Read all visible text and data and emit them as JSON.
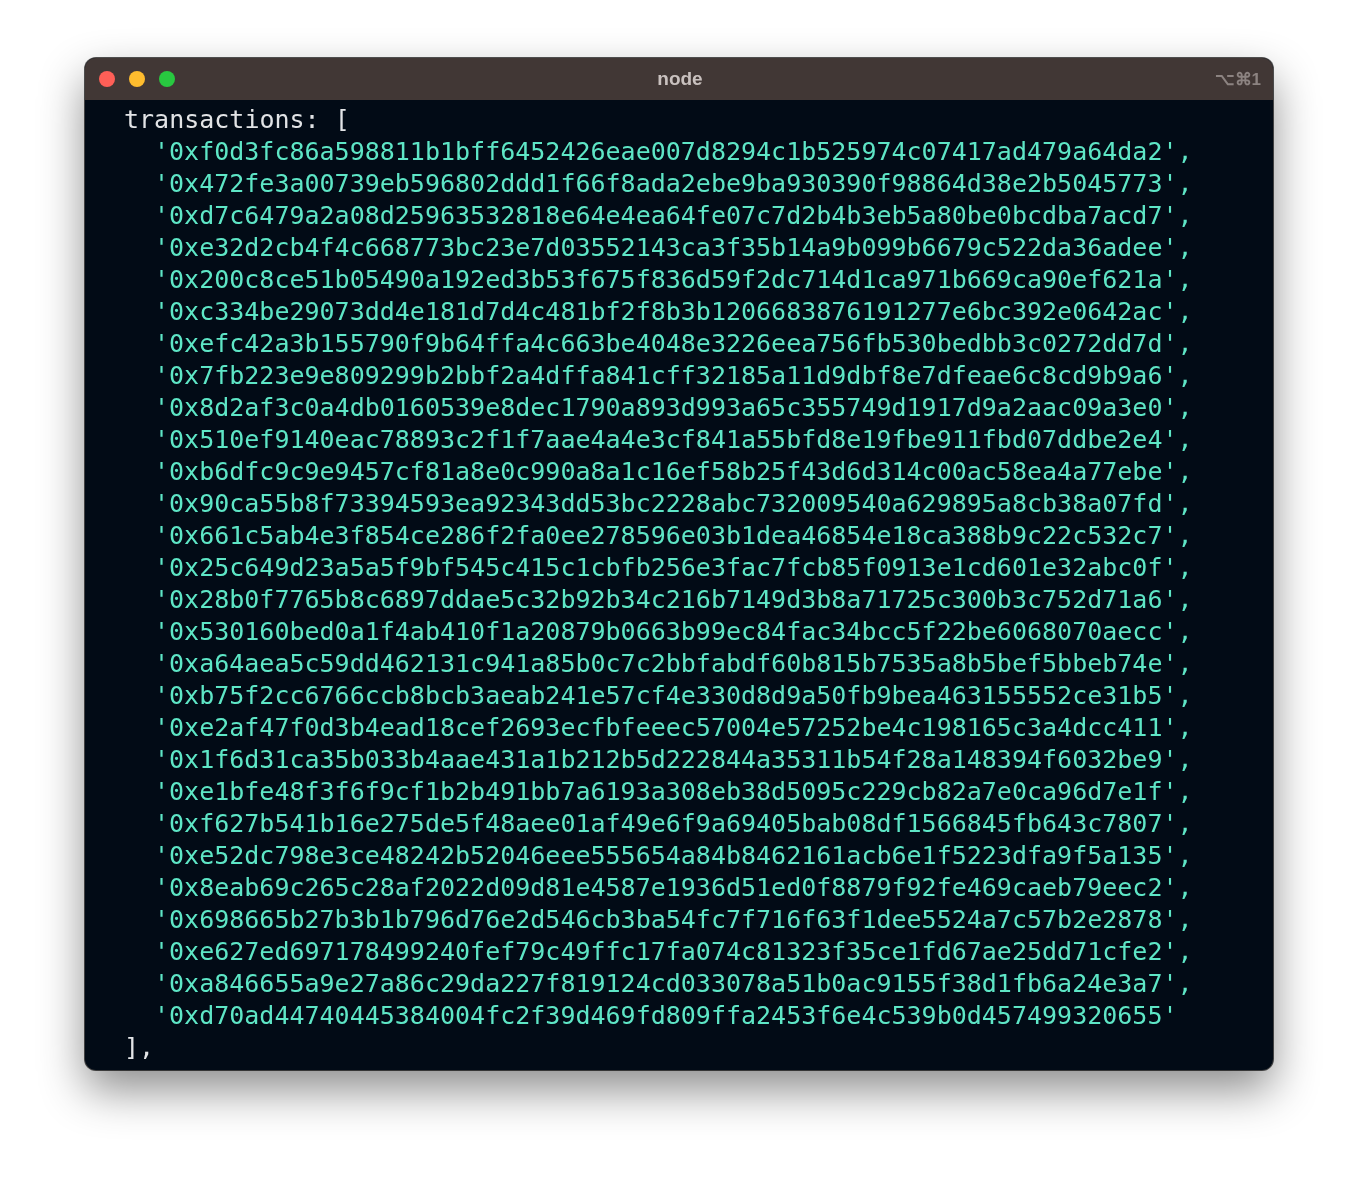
{
  "window": {
    "title": "node",
    "shortcut": "⌥⌘1"
  },
  "terminal": {
    "opening": "transactions: [",
    "lines": [
      "'0xf0d3fc86a598811b1bff6452426eae007d8294c1b525974c07417ad479a64da2',",
      "'0x472fe3a00739eb596802ddd1f66f8ada2ebe9ba930390f98864d38e2b5045773',",
      "'0xd7c6479a2a08d25963532818e64e4ea64fe07c7d2b4b3eb5a80be0bcdba7acd7',",
      "'0xe32d2cb4f4c668773bc23e7d03552143ca3f35b14a9b099b6679c522da36adee',",
      "'0x200c8ce51b05490a192ed3b53f675f836d59f2dc714d1ca971b669ca90ef621a',",
      "'0xc334be29073dd4e181d7d4c481bf2f8b3b1206683876191277e6bc392e0642ac',",
      "'0xefc42a3b155790f9b64ffa4c663be4048e3226eea756fb530bedbb3c0272dd7d',",
      "'0x7fb223e9e809299b2bbf2a4dffa841cff32185a11d9dbf8e7dfeae6c8cd9b9a6',",
      "'0x8d2af3c0a4db0160539e8dec1790a893d993a65c355749d1917d9a2aac09a3e0',",
      "'0x510ef9140eac78893c2f1f7aae4a4e3cf841a55bfd8e19fbe911fbd07ddbe2e4',",
      "'0xb6dfc9c9e9457cf81a8e0c990a8a1c16ef58b25f43d6d314c00ac58ea4a77ebe',",
      "'0x90ca55b8f73394593ea92343dd53bc2228abc732009540a629895a8cb38a07fd',",
      "'0x661c5ab4e3f854ce286f2fa0ee278596e03b1dea46854e18ca388b9c22c532c7',",
      "'0x25c649d23a5a5f9bf545c415c1cbfb256e3fac7fcb85f0913e1cd601e32abc0f',",
      "'0x28b0f7765b8c6897ddae5c32b92b34c216b7149d3b8a71725c300b3c752d71a6',",
      "'0x530160bed0a1f4ab410f1a20879b0663b99ec84fac34bcc5f22be6068070aecc',",
      "'0xa64aea5c59dd462131c941a85b0c7c2bbfabdf60b815b7535a8b5bef5bbeb74e',",
      "'0xb75f2cc6766ccb8bcb3aeab241e57cf4e330d8d9a50fb9bea463155552ce31b5',",
      "'0xe2af47f0d3b4ead18cef2693ecfbfeeec57004e57252be4c198165c3a4dcc411',",
      "'0x1f6d31ca35b033b4aae431a1b212b5d222844a35311b54f28a148394f6032be9',",
      "'0xe1bfe48f3f6f9cf1b2b491bb7a6193a308eb38d5095c229cb82a7e0ca96d7e1f',",
      "'0xf627b541b16e275de5f48aee01af49e6f9a69405bab08df1566845fb643c7807',",
      "'0xe52dc798e3ce48242b52046eee555654a84b8462161acb6e1f5223dfa9f5a135',",
      "'0x8eab69c265c28af2022d09d81e4587e1936d51ed0f8879f92fe469caeb79eec2',",
      "'0x698665b27b3b1b796d76e2d546cb3ba54fc7f716f63f1dee5524a7c57b2e2878',",
      "'0xe627ed697178499240fef79c49ffc17fa074c81323f35ce1fd67ae25dd71cfe2',",
      "'0xa846655a9e27a86c29da227f819124cd033078a51b0ac9155f38d1fb6a24e3a7',",
      "'0xd70ad44740445384004fc2f39d469fd809ffa2453f6e4c539b0d457499320655'"
    ],
    "closing": "],"
  }
}
